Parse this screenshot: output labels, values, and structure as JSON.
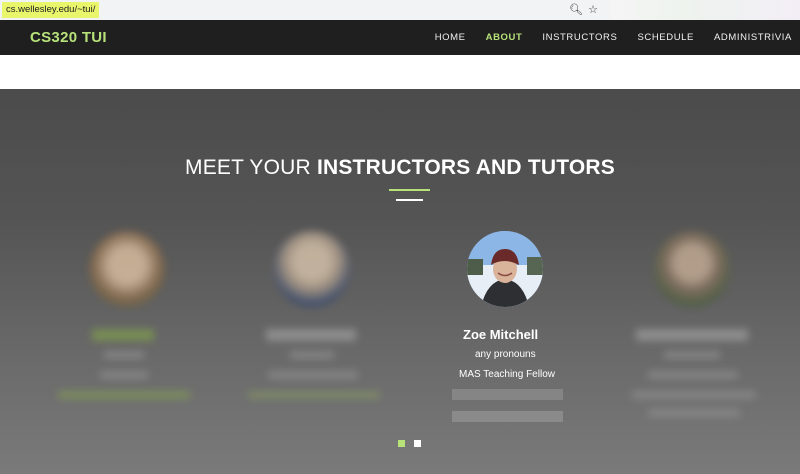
{
  "browser": {
    "url": "cs.wellesley.edu/~tui/",
    "zoom_icon": "zoom-icon",
    "star_icon": "star-icon"
  },
  "site": {
    "brand": "CS320 TUI",
    "nav": [
      "HOME",
      "ABOUT",
      "INSTRUCTORS",
      "SCHEDULE",
      "ADMINISTRIVIA"
    ],
    "active_nav": "ABOUT"
  },
  "section": {
    "heading_light": "MEET YOUR",
    "heading_bold": "INSTRUCTORS AND TUTORS"
  },
  "featured": {
    "name": "Zoe Mitchell",
    "pronouns": "any pronouns",
    "role": "MAS Teaching Fellow"
  },
  "carousel": {
    "pages": 2,
    "active_page": 1
  },
  "colors": {
    "accent": "#b7e27a",
    "navbar": "#1f1f1f"
  }
}
